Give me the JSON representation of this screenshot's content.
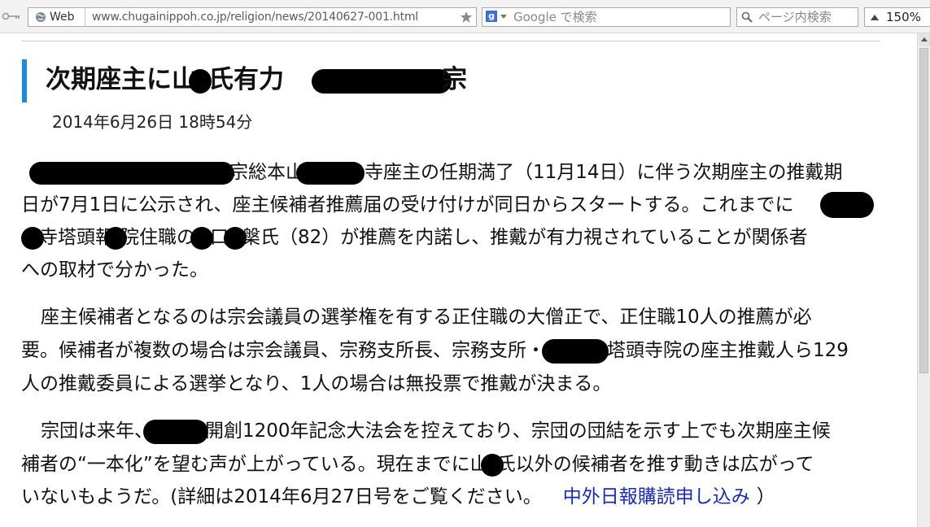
{
  "browser": {
    "site_label": "Web",
    "url": "www.chugainippoh.co.jp/religion/news/20140627-001.html",
    "search_placeholder": "Google で検索",
    "find_placeholder": "ページ内検索",
    "zoom": "150%"
  },
  "article": {
    "title_a": "次期座主に山",
    "title_b": "氏有力",
    "title_c": "宗",
    "date": "2014年6月26日 18時54分",
    "p1": {
      "l1_a": "宗総本山",
      "l1_b": "寺座主の任期満了（11月14日）に伴う次期座主の推戴期",
      "l2": "日が7月1日に公示され、座主候補者推薦届の受け付けが同日からスタートする。これまでに",
      "l3_a": "寺塔頭報",
      "l3_b": "院住職の",
      "l3_c": "口",
      "l3_d": "槃氏（82）が推薦を内諾し、推戴が有力視されていることが関係者",
      "l4": "への取材で分かった。"
    },
    "p2": {
      "l1": "座主候補者となるのは宗会議員の選挙権を有する正住職の大僧正で、正住職10人の推薦が必",
      "l2_a": "要。候補者が複数の場合は宗会議員、宗務支所長、宗務支所・",
      "l2_b": "塔頭寺院の座主推戴人ら129",
      "l3": "人の推戴委員による選挙となり、1人の場合は無投票で推戴が決まる。"
    },
    "p3": {
      "l1_a": "宗団は来年、",
      "l1_b": "開創1200年記念大法会を控えており、宗団の団結を示す上でも次期座主候",
      "l2": "補者の“一本化”を望む声が上がっている。現在までに山",
      "l2_b": "氏以外の候補者を推す動きは広がって",
      "l3": "いないもようだ。(詳細は2014年6月27日号をご覧ください。",
      "link": "中外日報購読申し込み",
      "close": "）"
    }
  }
}
